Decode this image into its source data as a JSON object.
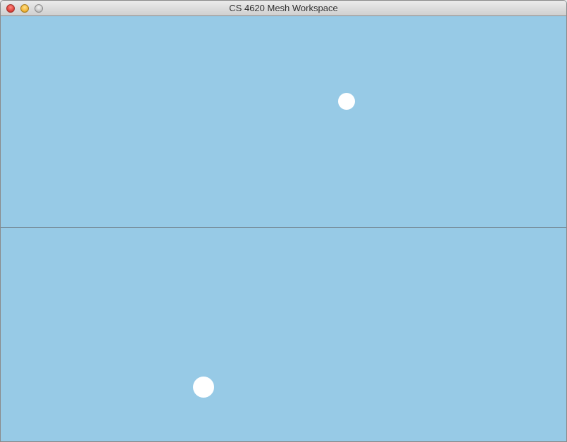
{
  "window": {
    "title": "CS 4620 Mesh Workspace"
  },
  "colors": {
    "viewport_background": "#97cae6",
    "point_fill": "#ffffff",
    "divider": "#6f7f8a"
  },
  "viewports": {
    "top": {
      "content": "white point"
    },
    "bottom": {
      "content": "white point"
    }
  }
}
